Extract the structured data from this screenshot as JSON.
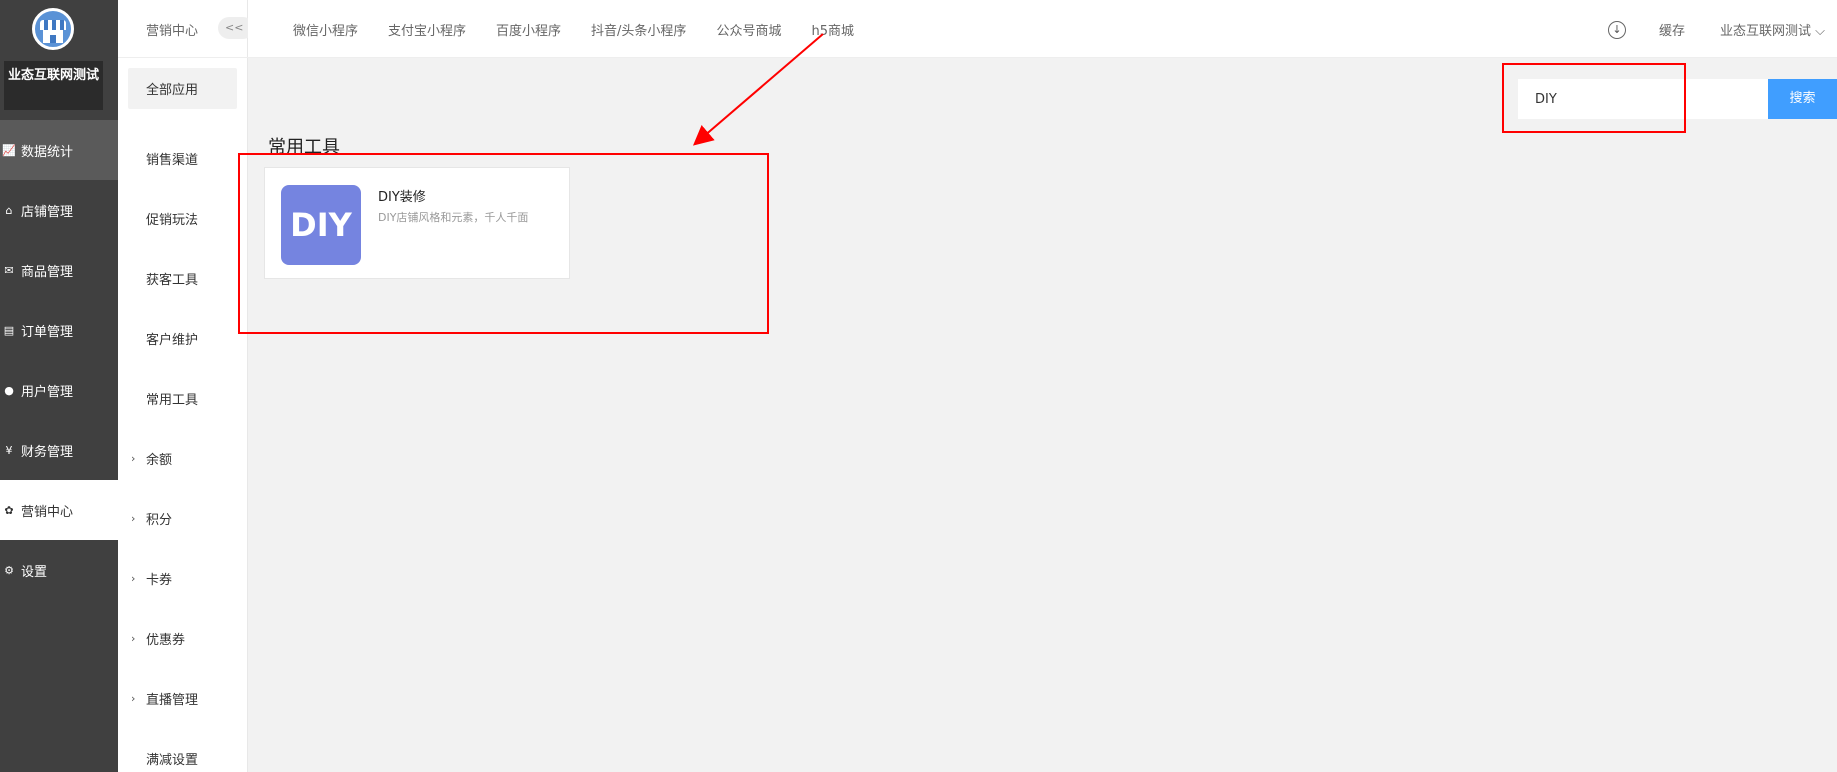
{
  "sidebar": {
    "shop_name": "业态互联网测试",
    "items": [
      {
        "label": "数据统计",
        "icon": "chart-icon",
        "glyph": "📈"
      },
      {
        "label": "店铺管理",
        "icon": "store-icon",
        "glyph": "⌂"
      },
      {
        "label": "商品管理",
        "icon": "box-icon",
        "glyph": "✉"
      },
      {
        "label": "订单管理",
        "icon": "clipboard-icon",
        "glyph": "▤"
      },
      {
        "label": "用户管理",
        "icon": "user-icon",
        "glyph": "●"
      },
      {
        "label": "财务管理",
        "icon": "yen-icon",
        "glyph": "¥"
      },
      {
        "label": "营销中心",
        "icon": "marketing-icon",
        "glyph": "✿"
      },
      {
        "label": "设置",
        "icon": "gear-icon",
        "glyph": "⚙"
      }
    ]
  },
  "submenu": {
    "title": "营销中心",
    "collapse": "<<",
    "items": [
      {
        "label": "全部应用",
        "expandable": false
      },
      {
        "label": "销售渠道",
        "expandable": false
      },
      {
        "label": "促销玩法",
        "expandable": false
      },
      {
        "label": "获客工具",
        "expandable": false
      },
      {
        "label": "客户维护",
        "expandable": false
      },
      {
        "label": "常用工具",
        "expandable": false
      },
      {
        "label": "余额",
        "expandable": true
      },
      {
        "label": "积分",
        "expandable": true
      },
      {
        "label": "卡券",
        "expandable": true
      },
      {
        "label": "优惠券",
        "expandable": true
      },
      {
        "label": "直播管理",
        "expandable": true
      },
      {
        "label": "满减设置",
        "expandable": false
      }
    ]
  },
  "topbar": {
    "tabs": [
      "微信小程序",
      "支付宝小程序",
      "百度小程序",
      "抖音/头条小程序",
      "公众号商城",
      "h5商城"
    ],
    "cache": "缓存",
    "account": "业态互联网测试"
  },
  "search": {
    "value": "DIY",
    "button": "搜索"
  },
  "main": {
    "section_title": "常用工具",
    "card": {
      "icon_text": "DIY",
      "name": "DIY装修",
      "desc": "DIY店铺风格和元素，千人千面"
    }
  },
  "colors": {
    "sidebar_bg": "#404040",
    "accent": "#409eff",
    "card_icon": "#7584e0",
    "annotation": "#ff0000"
  }
}
